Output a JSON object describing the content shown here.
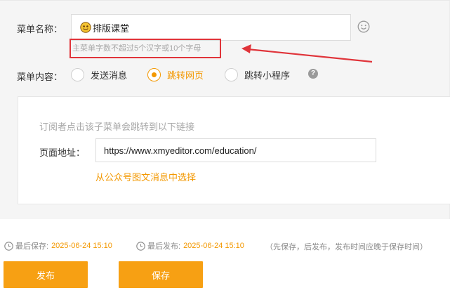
{
  "form": {
    "menu_name_label": "菜单名称：",
    "menu_name_value": "排版课堂",
    "menu_name_hint": "主菜单字数不超过5个汉字或10个字母",
    "menu_content_label": "菜单内容：",
    "content_options": [
      {
        "label": "发送消息",
        "checked": false
      },
      {
        "label": "跳转网页",
        "checked": true
      },
      {
        "label": "跳转小程序",
        "checked": false
      }
    ],
    "help_icon_glyph": "?",
    "link_description": "订阅者点击该子菜单会跳转到以下链接",
    "page_url_label": "页面地址：",
    "page_url_value": "https://www.xmyeditor.com/education/",
    "pick_from_articles": "从公众号图文消息中选择"
  },
  "status": {
    "last_saved_label": "最后保存:",
    "last_saved_time": "2025-06-24 15:10",
    "last_published_label": "最后发布:",
    "last_published_time": "2025-06-24 15:10",
    "note": "（先保存，后发布，发布时间应晚于保存时间）"
  },
  "actions": {
    "publish_label": "发布",
    "save_label": "保存"
  },
  "colors": {
    "accent": "#f39800",
    "button": "#f7a013",
    "annotation": "#e0343a"
  },
  "icons": [
    "emoji-icon",
    "smiley-icon",
    "help-icon",
    "clock-icon",
    "arrow-annotation"
  ]
}
